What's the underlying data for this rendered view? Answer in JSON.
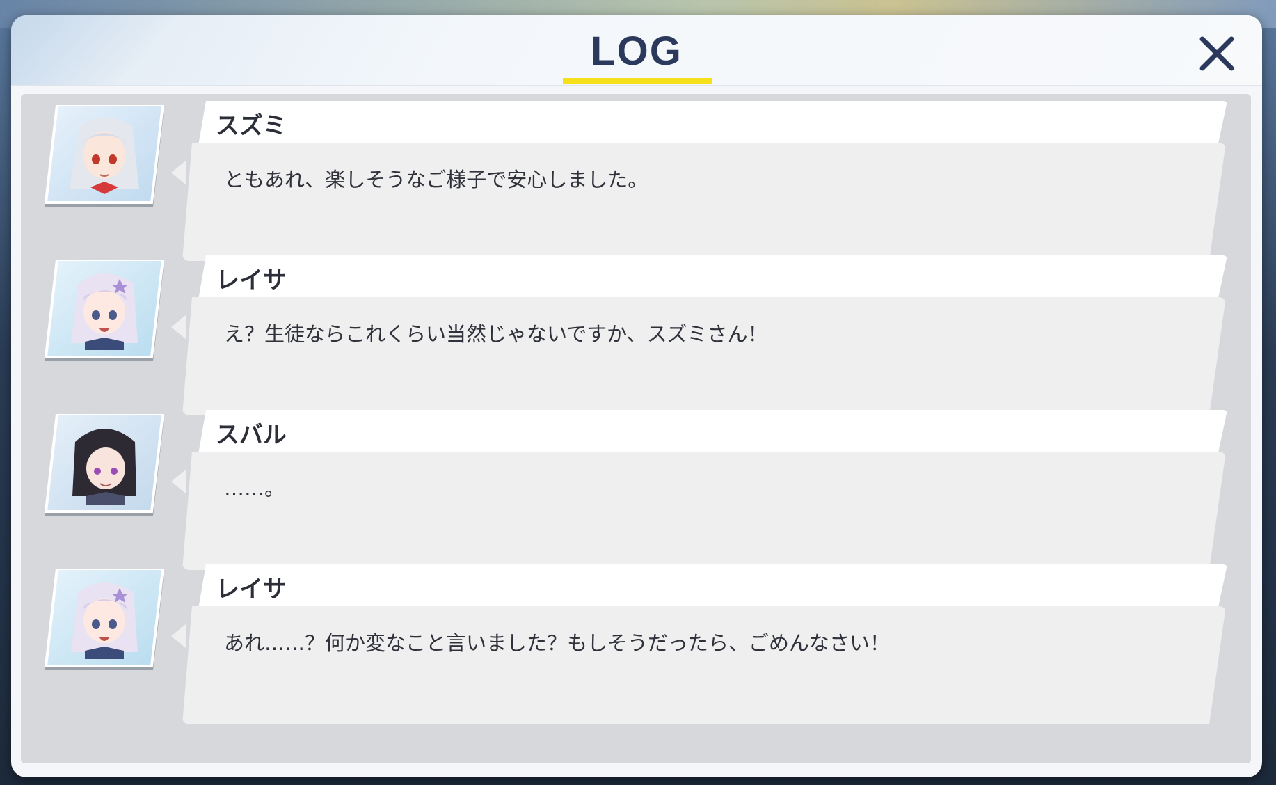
{
  "window": {
    "title": "LOG",
    "close_icon": "close-icon"
  },
  "colors": {
    "title": "#2b3a5c",
    "underline": "#f6e01c",
    "panel": "#d6d8dc",
    "name_bar": "#ffffff",
    "message_box": "#efefef"
  },
  "log": {
    "entries": [
      {
        "speaker": "スズミ",
        "message": "ともあれ、楽しそうなご様子で安心しました。",
        "portrait": "avatar-suzumi"
      },
      {
        "speaker": "レイサ",
        "message": "え？生徒ならこれくらい当然じゃないですか、スズミさん！",
        "portrait": "avatar-reisa"
      },
      {
        "speaker": "スバル",
        "message": "……。",
        "portrait": "avatar-subaru"
      },
      {
        "speaker": "レイサ",
        "message": "あれ……？何か変なこと言いました？もしそうだったら、ごめんなさい！",
        "portrait": "avatar-reisa"
      }
    ]
  }
}
